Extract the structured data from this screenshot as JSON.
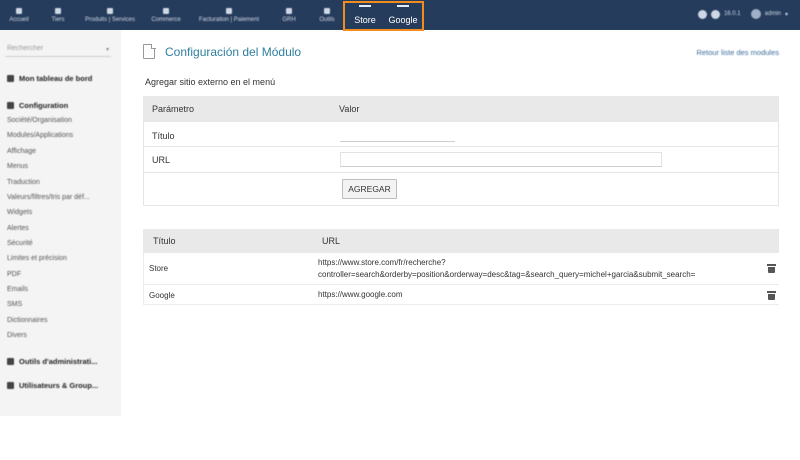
{
  "topbar": {
    "menus": [
      "Accueil",
      "Tiers",
      "Produits | Services",
      "Commerce",
      "Facturation | Paiement",
      "GRH",
      "Outils"
    ],
    "ext_menus": [
      "Store",
      "Google"
    ],
    "version": "16.0.1",
    "user": "admin"
  },
  "sidebar": {
    "search_placeholder": "Rechercher",
    "sections": [
      {
        "label": "Mon tableau de bord",
        "icon": "dashboard-icon"
      },
      {
        "label": "Configuration",
        "icon": "wrench-icon"
      },
      {
        "label": "Outils d'administrati...",
        "icon": "admin-tools-icon"
      },
      {
        "label": "Utilisateurs & Group...",
        "icon": "users-icon"
      }
    ],
    "items": [
      "Société/Organisation",
      "Modules/Applications",
      "Affichage",
      "Menus",
      "Traduction",
      "Valeurs/filtres/tris par déf...",
      "Widgets",
      "Alertes",
      "Sécurité",
      "Limites et précision",
      "PDF",
      "Emails",
      "SMS",
      "Dictionnaires",
      "Divers"
    ]
  },
  "main": {
    "title": "Configuración del Módulo",
    "back_link": "Retour liste des modules",
    "subtitle": "Agregar sitio externo en  el menú",
    "form": {
      "col_param": "Parámetro",
      "col_value": "Valor",
      "label_title": "Título",
      "label_url": "URL",
      "title_value": "",
      "url_value": "",
      "button": "AGREGAR"
    },
    "list": {
      "col_title": "Título",
      "col_url": "URL",
      "rows": [
        {
          "title": "Store",
          "url_line1": "https://www.store.com/fr/recherche?",
          "url_line2": "controller=search&orderby=position&orderway=desc&tag=&search_query=michel+garcia&submit_search="
        },
        {
          "title": "Google",
          "url_line1": "https://www.google.com",
          "url_line2": ""
        }
      ]
    }
  },
  "colors": {
    "topbar": "#263c5c",
    "highlight": "#f28c1c",
    "title": "#2f7f9f",
    "link": "#3a6b9a"
  }
}
